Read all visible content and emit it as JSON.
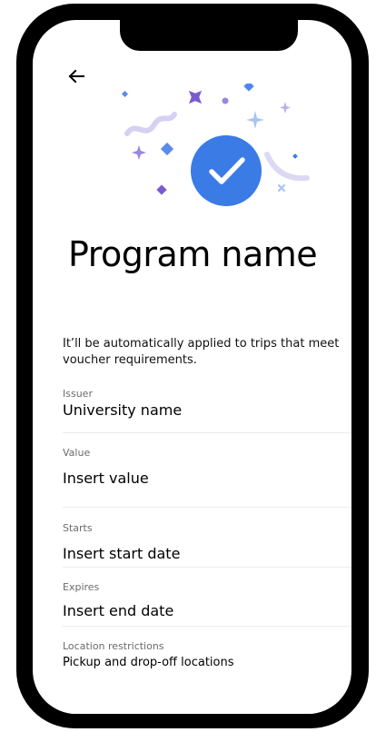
{
  "header": {
    "back_icon": "arrow-left-icon"
  },
  "hero": {
    "icon": "checkmark-circle-icon",
    "accent_color": "#3A7BE6",
    "confetti_colors": [
      "#B8B0E8",
      "#5A8BE8",
      "#7A5CCF",
      "#9B87E0"
    ]
  },
  "program": {
    "title": "Program name",
    "description": "It’ll be automatically applied to trips that meet voucher requirements."
  },
  "fields": {
    "issuer": {
      "label": "Issuer",
      "value": "University name"
    },
    "value": {
      "label": "Value",
      "value": "Insert value"
    },
    "starts": {
      "label": "Starts",
      "value": "Insert start date"
    },
    "expires": {
      "label": "Expires",
      "value": "Insert end date"
    },
    "location": {
      "label": "Location restrictions",
      "value": "Pickup and drop-off locations"
    }
  }
}
